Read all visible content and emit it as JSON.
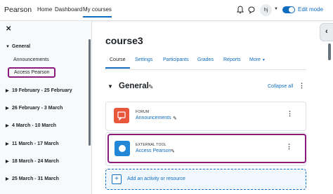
{
  "navbar": {
    "brand": "Pearson",
    "links": [
      "Home",
      "Dashboard",
      "My courses"
    ],
    "avatar_initials": "hj",
    "edit_mode_label": "Edit mode"
  },
  "drawer": {
    "sections": [
      {
        "title": "General",
        "expanded": true,
        "items": [
          "Announcements",
          "Access Pearson"
        ]
      },
      {
        "title": "19 February - 25 February"
      },
      {
        "title": "26 February - 3 March"
      },
      {
        "title": "4 March - 10 March"
      },
      {
        "title": "11 March - 17 March"
      },
      {
        "title": "18 March - 24 March"
      },
      {
        "title": "25 March - 31 March"
      }
    ]
  },
  "course": {
    "title": "course3",
    "tabs": [
      "Course",
      "Settings",
      "Participants",
      "Grades",
      "Reports",
      "More"
    ],
    "section_title": "General",
    "collapse_all": "Collapse all",
    "activities": [
      {
        "type": "FORUM",
        "name": "Announcements",
        "icon_color": "#e8563c",
        "icon": "forum-icon"
      },
      {
        "type": "EXTERNAL TOOL",
        "name": "Access Pearson",
        "icon_color": "#2187d6",
        "icon": "lti-icon"
      }
    ],
    "add_activity": "Add an activity or resource"
  },
  "colors": {
    "accent": "#0f6cbf",
    "highlight": "#8b1b7e"
  }
}
